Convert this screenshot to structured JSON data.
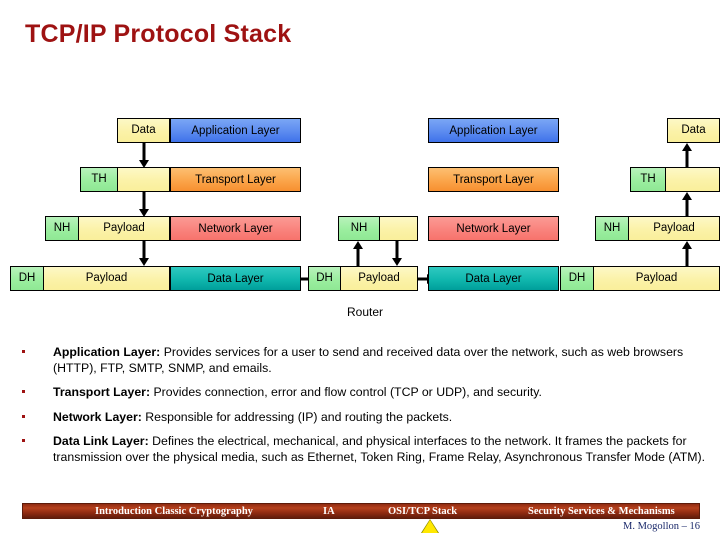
{
  "slide": {
    "title": "TCP/IP Protocol Stack"
  },
  "diagram": {
    "router_label": "Router",
    "labels": {
      "data": "Data",
      "th": "TH",
      "nh": "NH",
      "dh": "DH",
      "payload": "Payload",
      "empty": ""
    },
    "layers": {
      "application": "Application Layer",
      "transport": "Transport Layer",
      "network": "Network Layer",
      "data_link": "Data Layer"
    },
    "colors": {
      "application": "#5f8ef0",
      "transport": "#fba54a",
      "network": "#f9837d",
      "data_link": "#10b7ae",
      "header": "#9bee9f",
      "payload": "#fbf2a8",
      "title": "#9e1212"
    },
    "host_left": {
      "row_app": {
        "data": "Data"
      },
      "row_tra": {
        "header": "TH",
        "payload": ""
      },
      "row_net": {
        "header": "NH",
        "payload": "Payload"
      },
      "row_dat": {
        "header": "DH",
        "payload": "Payload"
      }
    },
    "router": {
      "row_net": {
        "header": "NH",
        "payload": ""
      },
      "row_dat": {
        "header": "DH",
        "payload": "Payload"
      }
    },
    "host_right": {
      "row_app": {
        "data": "Data"
      },
      "row_tra": {
        "header": "TH",
        "payload": ""
      },
      "row_net": {
        "header": "NH",
        "payload": "Payload"
      },
      "row_dat": {
        "header": "DH",
        "payload": "Payload"
      }
    }
  },
  "bullets": [
    {
      "term": "Application Layer:",
      "text": " Provides services for a user to send and received data over the network, such as web browsers (HTTP), FTP, SMTP, SNMP, and emails."
    },
    {
      "term": "Transport Layer:",
      "text": " Provides connection, error and flow control (TCP or UDP), and security."
    },
    {
      "term": "Network Layer:",
      "text": " Responsible for addressing (IP) and routing the packets."
    },
    {
      "term": "Data Link Layer:",
      "text": " Defines the electrical, mechanical, and physical interfaces to the network. It frames the packets for transmission over the physical media, such as Ethernet, Token Ring, Frame Relay, Asynchronous Transfer Mode (ATM)."
    }
  ],
  "footer": {
    "items": [
      "Introduction  Classic Cryptography",
      "IA",
      "OSI/TCP Stack",
      "Security Services & Mechanisms"
    ],
    "author": "M. Mogollon – 16",
    "marker_color": "#ffe800"
  }
}
